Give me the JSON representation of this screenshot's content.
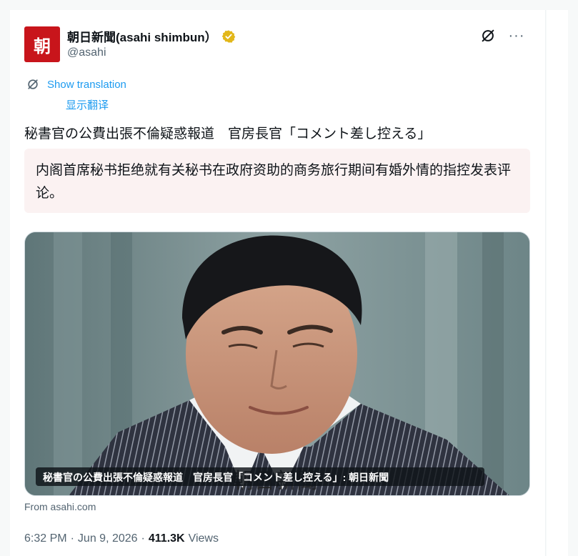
{
  "tweet": {
    "avatar_text": "朝",
    "display_name": "朝日新聞(asahi shimbun）",
    "handle": "@asahi",
    "show_translation": "Show translation",
    "show_translation_sub": "显示翻译",
    "text": "秘書官の公費出張不倫疑惑報道　官房長官「コメント差し控える」",
    "translated_text": "内阁首席秘书拒绝就有关秘书在政府资助的商务旅行期间有婚外情的指控发表评论。",
    "media_caption": "秘書官の公費出張不倫疑惑報道　官房長官「コメント差し控える」: 朝日新聞",
    "media_overlay_text": "朝日新聞",
    "source": "From asahi.com",
    "time": "6:32 PM",
    "date": "Jun 9, 2026",
    "views_count": "411.3K",
    "views_label": "Views",
    "separator": "·",
    "more_label": "···"
  },
  "colors": {
    "link": "#1d9bf0",
    "secondary_text": "#536471",
    "verified_badge": "#e2b719",
    "avatar_bg": "#c8151b",
    "translation_bg": "#fbf2f2"
  },
  "icons": {
    "verified": "verified-badge-icon",
    "grok": "grok-icon",
    "more": "more-icon",
    "translate": "translate-icon"
  }
}
